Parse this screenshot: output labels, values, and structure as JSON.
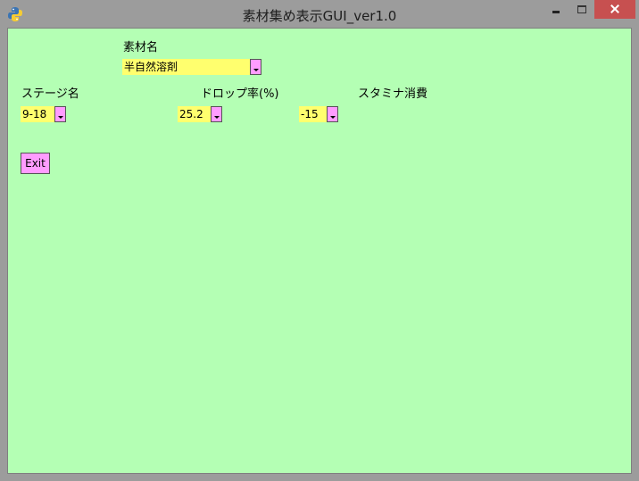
{
  "window": {
    "title": "素材集め表示GUI_ver1.0"
  },
  "material": {
    "label": "素材名",
    "value": "半自然溶剤"
  },
  "stage": {
    "label": "ステージ名",
    "value": "9-18"
  },
  "drop_rate": {
    "label": "ドロップ率(%)",
    "value": "25.2"
  },
  "stamina": {
    "label": "スタミナ消費",
    "value": "-15"
  },
  "exit": {
    "label": "Exit"
  },
  "colors": {
    "background": "#b4ffb4",
    "combo_field": "#ffff6e",
    "combo_button": "#ff9cff",
    "exit_button": "#ff9cff",
    "close_button": "#c75050"
  }
}
